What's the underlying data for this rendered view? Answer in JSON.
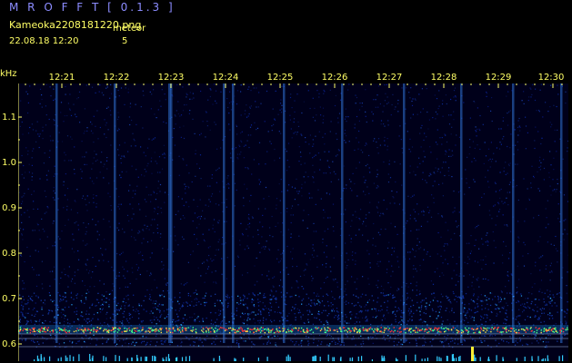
{
  "header": {
    "app_title": "M R O F F T  [ 0.1.3 ]",
    "file_name": "Kameoka2208181220.png",
    "meteor_label": "meteor",
    "timestamp": "22.08.18  12:20",
    "meteor_count": "5"
  },
  "axis": {
    "unit": "kHz",
    "y_labels": [
      "1.1",
      "1.0",
      "0.9",
      "0.8",
      "0.7",
      "0.6"
    ],
    "x_labels": [
      "12:21",
      "12:22",
      "12:23",
      "12:24",
      "12:25",
      "12:26",
      "12:27",
      "12:28",
      "12:29",
      "12:30"
    ]
  },
  "colors": {
    "background": "#000000",
    "noise": "#0a1a8a",
    "meteor_trail": "#55aaff",
    "carrier": "#ff3333",
    "label": "#ffff66",
    "title": "#8c8cff"
  }
}
